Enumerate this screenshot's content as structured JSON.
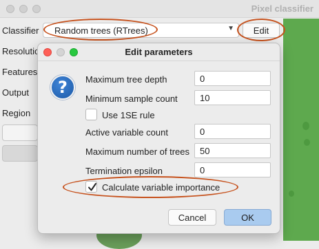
{
  "main_window": {
    "title": "Pixel classifier",
    "labels": {
      "classifier": "Classifier",
      "resolution": "Resolutio",
      "features": "Features",
      "output": "Output",
      "region": "Region"
    },
    "classifier_select": {
      "value": "Random trees (RTrees)"
    },
    "edit_button": "Edit"
  },
  "dialog": {
    "title": "Edit parameters",
    "fields": [
      {
        "label": "Maximum tree depth",
        "value": "0"
      },
      {
        "label": "Minimum sample count",
        "value": "10"
      },
      {
        "label": "Active variable count",
        "value": "0"
      },
      {
        "label": "Maximum number of trees",
        "value": "50"
      },
      {
        "label": "Termination epsilon",
        "value": "0"
      }
    ],
    "use_1se": {
      "label": "Use 1SE rule",
      "checked": false
    },
    "var_importance": {
      "label": "Calculate variable importance",
      "checked": true
    },
    "cancel_button": "Cancel",
    "ok_button": "OK"
  },
  "colors": {
    "annotation": "#c6511c",
    "ok_button": "#a9cbef",
    "close": "#fe5f57",
    "minimize": "#febc2e",
    "maximize": "#28c840",
    "image_green": "#5ea94e"
  }
}
